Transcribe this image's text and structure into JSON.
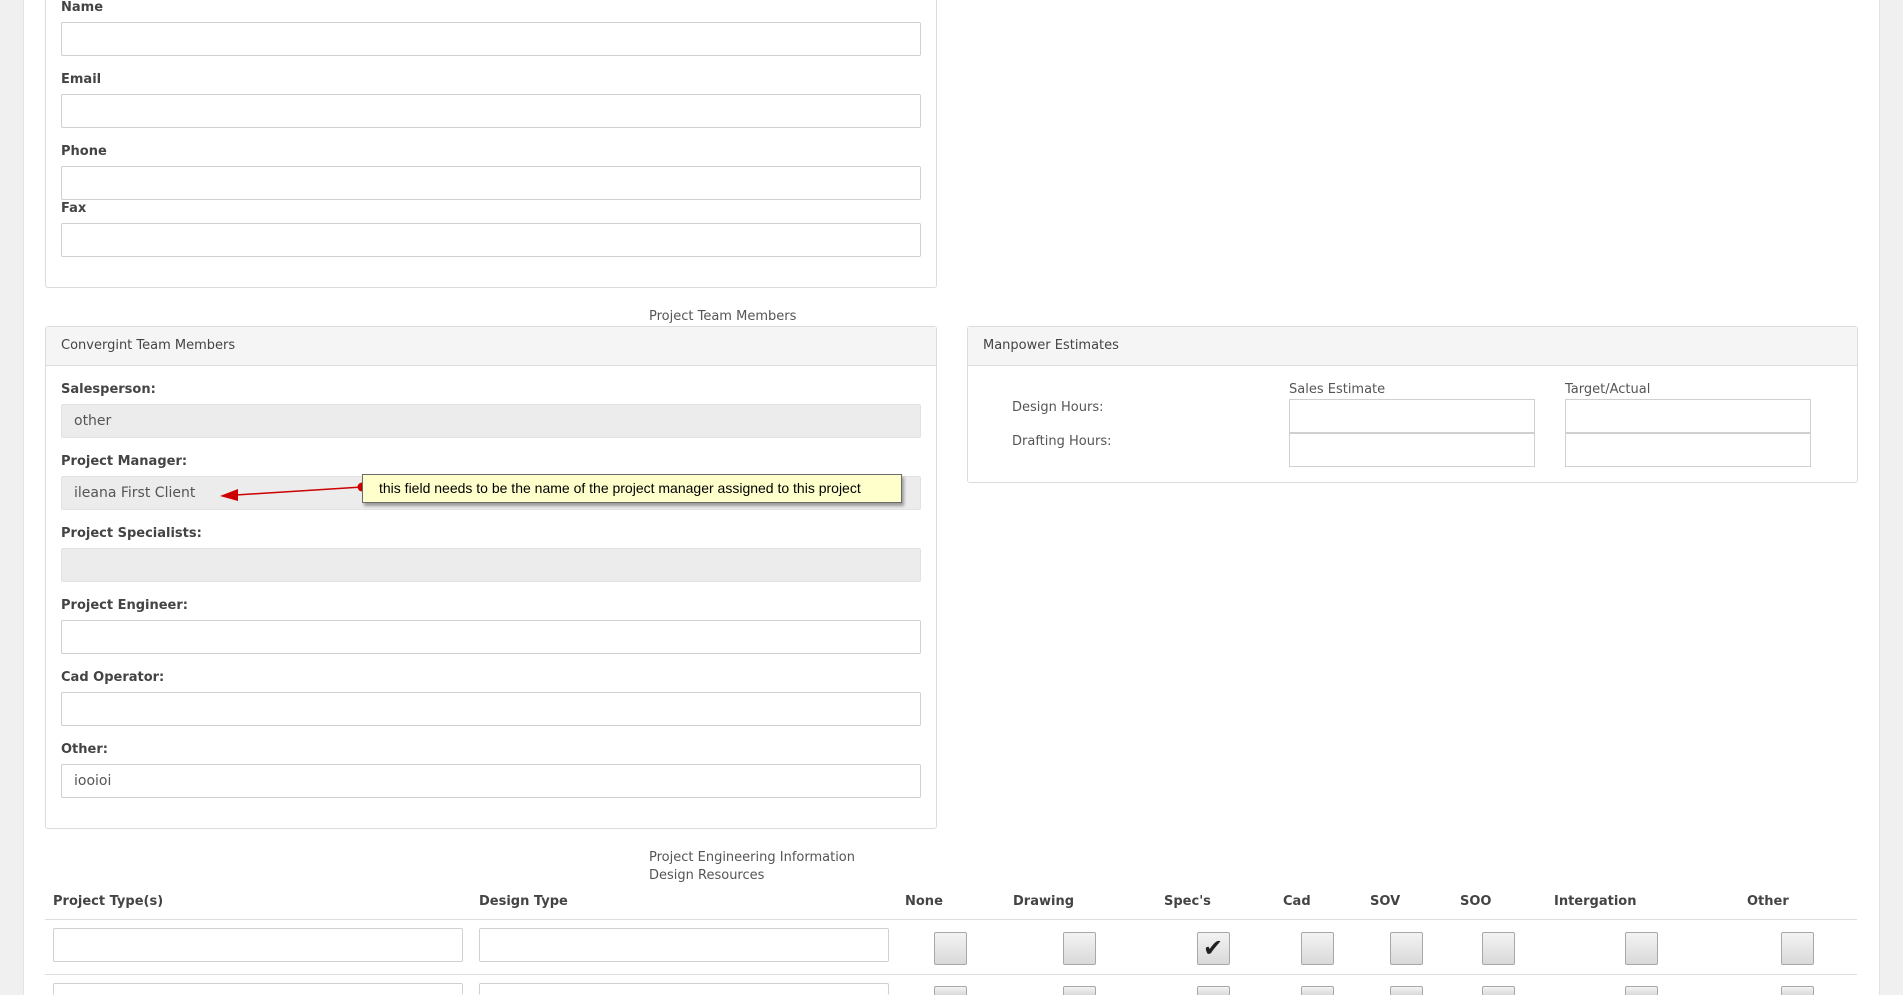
{
  "contact": {
    "name_label": "Name",
    "email_label": "Email",
    "phone_label": "Phone",
    "fax_label": "Fax",
    "name_value": "",
    "email_value": "",
    "phone_value": "",
    "fax_value": ""
  },
  "team": {
    "section_title": "Project Team Members",
    "panel_title": "Convergint Team Members",
    "salesperson_label": "Salesperson:",
    "salesperson_value": "other",
    "pm_label": "Project Manager:",
    "pm_value": "ileana First Client",
    "specialists_label": "Project Specialists:",
    "specialists_value": "",
    "engineer_label": "Project Engineer:",
    "engineer_value": "",
    "cad_label": "Cad Operator:",
    "cad_value": "",
    "other_label": "Other:",
    "other_value": "iooioi"
  },
  "manpower": {
    "panel_title": "Manpower Estimates",
    "col_sales": "Sales Estimate",
    "col_target": "Target/Actual",
    "design_label": "Design Hours:",
    "drafting_label": "Drafting Hours:"
  },
  "engineering": {
    "section_title": "Project Engineering Information",
    "subsection_title": "Design Resources",
    "columns": [
      "Project Type(s)",
      "Design Type",
      "None",
      "Drawing",
      "Spec's",
      "Cad",
      "SOV",
      "SOO",
      "Intergation",
      "Other"
    ],
    "row1_checked": [
      false,
      false,
      true,
      false,
      false,
      false,
      false,
      false
    ]
  },
  "annotation": {
    "text": "this field needs to be the name of the project manager assigned to this project",
    "arrow_color": "#cc0000"
  }
}
